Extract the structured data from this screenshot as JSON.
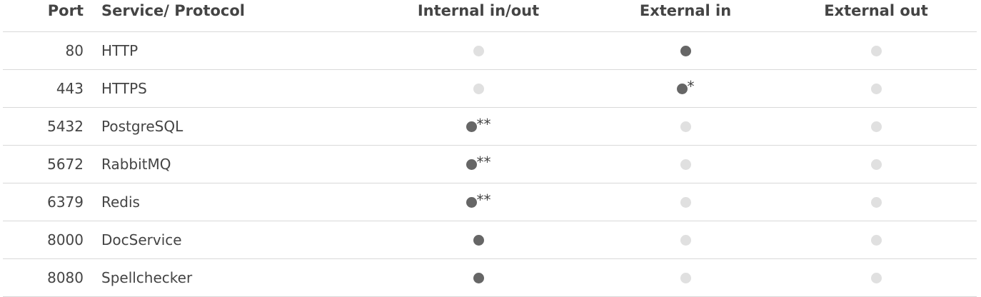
{
  "table": {
    "headers": {
      "port": "Port",
      "service": "Service/ Protocol",
      "internal": "Internal in/out",
      "external_in": "External in",
      "external_out": "External out"
    },
    "rows": [
      {
        "port": "80",
        "service": "HTTP",
        "internal": {
          "state": "inactive",
          "note": ""
        },
        "external_in": {
          "state": "active",
          "note": ""
        },
        "external_out": {
          "state": "inactive",
          "note": ""
        }
      },
      {
        "port": "443",
        "service": "HTTPS",
        "internal": {
          "state": "inactive",
          "note": ""
        },
        "external_in": {
          "state": "active",
          "note": "*"
        },
        "external_out": {
          "state": "inactive",
          "note": ""
        }
      },
      {
        "port": "5432",
        "service": "PostgreSQL",
        "internal": {
          "state": "active",
          "note": "**"
        },
        "external_in": {
          "state": "inactive",
          "note": ""
        },
        "external_out": {
          "state": "inactive",
          "note": ""
        }
      },
      {
        "port": "5672",
        "service": "RabbitMQ",
        "internal": {
          "state": "active",
          "note": "**"
        },
        "external_in": {
          "state": "inactive",
          "note": ""
        },
        "external_out": {
          "state": "inactive",
          "note": ""
        }
      },
      {
        "port": "6379",
        "service": "Redis",
        "internal": {
          "state": "active",
          "note": "**"
        },
        "external_in": {
          "state": "inactive",
          "note": ""
        },
        "external_out": {
          "state": "inactive",
          "note": ""
        }
      },
      {
        "port": "8000",
        "service": "DocService",
        "internal": {
          "state": "active",
          "note": ""
        },
        "external_in": {
          "state": "inactive",
          "note": ""
        },
        "external_out": {
          "state": "inactive",
          "note": ""
        }
      },
      {
        "port": "8080",
        "service": "Spellchecker",
        "internal": {
          "state": "active",
          "note": ""
        },
        "external_in": {
          "state": "inactive",
          "note": ""
        },
        "external_out": {
          "state": "inactive",
          "note": ""
        }
      }
    ]
  },
  "colors": {
    "active_dot": "#666666",
    "inactive_dot": "#e0e0e0",
    "divider": "#d9d9d9",
    "text": "#444444"
  }
}
